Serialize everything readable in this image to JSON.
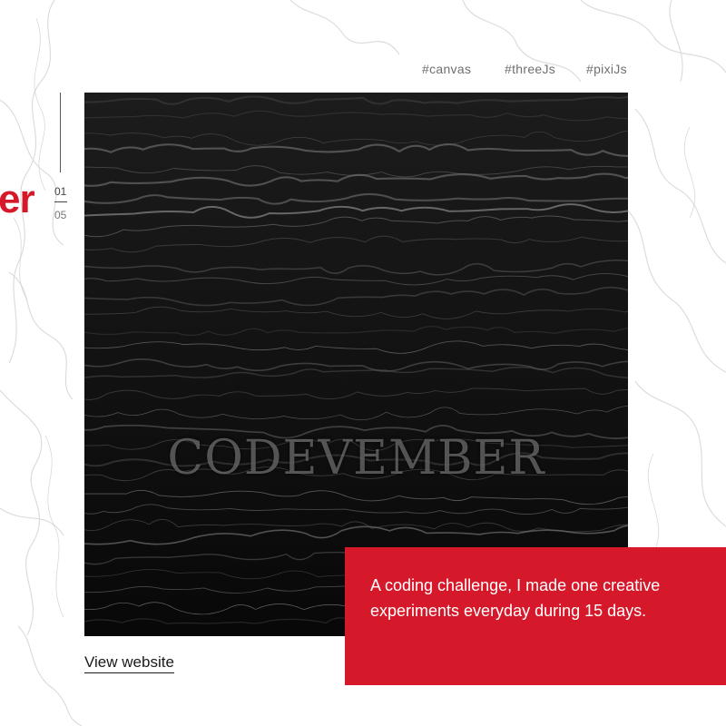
{
  "tags": [
    "#canvas",
    "#threeJs",
    "#pixiJs"
  ],
  "project": {
    "title_visible": "er",
    "overlay_text": "CODEVEMBER",
    "index_current": "01",
    "index_total": "05"
  },
  "link": {
    "label": "View website"
  },
  "description": "A coding challenge, I made one creative experiments everyday during 15 days.",
  "colors": {
    "accent": "#d6192a",
    "background": "#ffffff",
    "image_dark": "#0c0c0c",
    "text": "#1a1a1a",
    "tag_text": "#6f6f6f"
  },
  "icons": []
}
